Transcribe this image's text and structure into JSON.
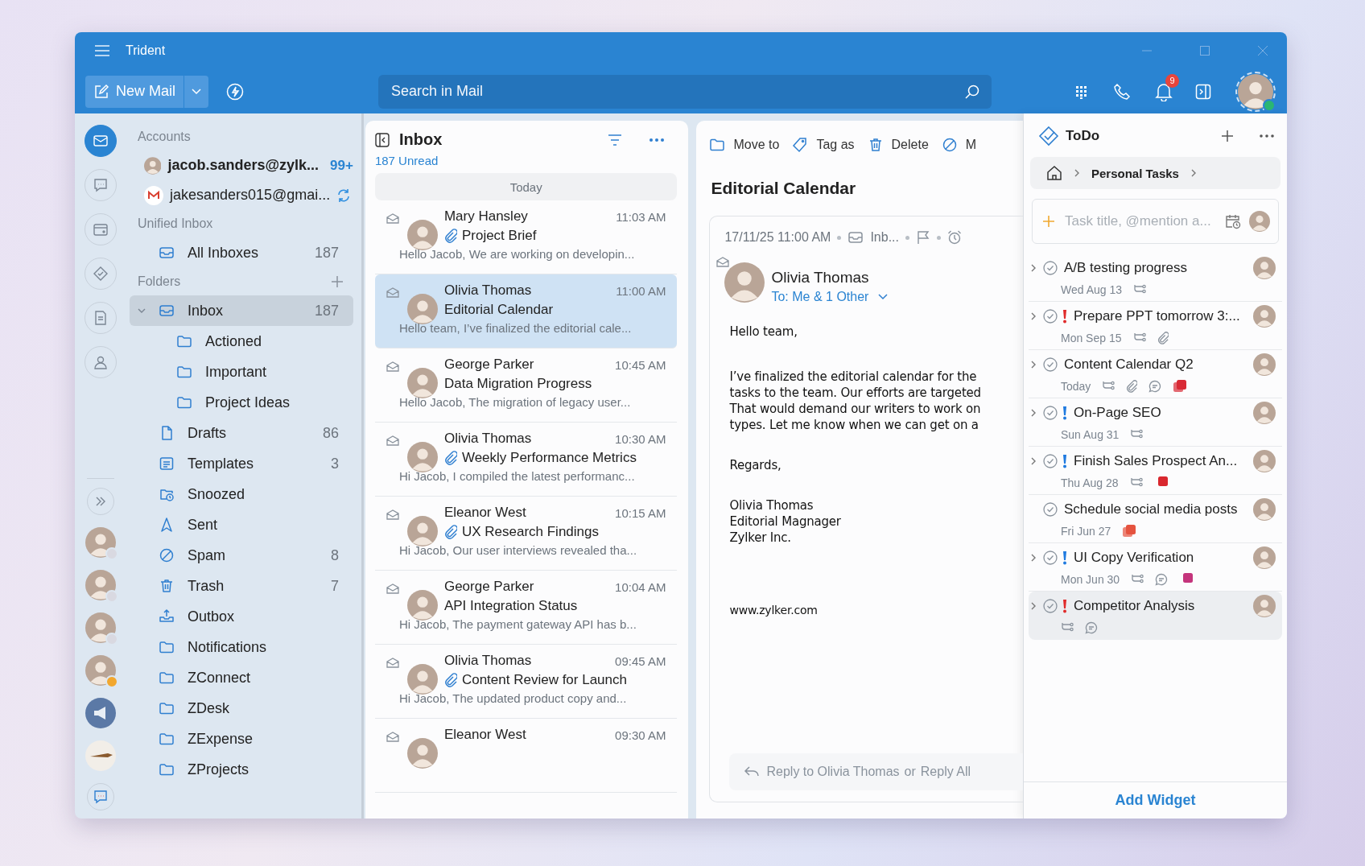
{
  "window": {
    "title": "Trident"
  },
  "toolbar": {
    "new_mail": "New Mail",
    "search_placeholder": "Search in Mail",
    "notification_count": "9"
  },
  "rail": {
    "apps": [
      {
        "kind": "mail",
        "selected": true
      },
      {
        "kind": "chat",
        "selected": false
      },
      {
        "kind": "drive",
        "selected": false
      },
      {
        "kind": "tasks",
        "selected": false
      },
      {
        "kind": "notes",
        "selected": false
      },
      {
        "kind": "contacts",
        "selected": false
      }
    ],
    "contacts": [
      {
        "kind": "person",
        "color": "#d9d9e1"
      },
      {
        "kind": "person",
        "color": "#d9d9e1"
      },
      {
        "kind": "person",
        "color": "#d9d9e1"
      },
      {
        "kind": "person",
        "color": "#f2a72e"
      },
      {
        "kind": "channel"
      },
      {
        "kind": "bot"
      }
    ]
  },
  "accounts": {
    "label": "Accounts",
    "items": [
      {
        "kind": "zoho",
        "email": "jacob.sanders@zylk...",
        "count": "99+",
        "syncing": false
      },
      {
        "kind": "gmail",
        "email": "jakesanders015@gmai...",
        "syncing": true
      }
    ]
  },
  "unified": {
    "label": "Unified Inbox",
    "items": [
      {
        "kind": "inbox",
        "label": "All Inboxes",
        "count": "187",
        "selected": false
      }
    ]
  },
  "folders": {
    "label": "Folders",
    "items": [
      {
        "kind": "inbox",
        "label": "Inbox",
        "count": "187",
        "selected": true,
        "expanded": true,
        "children": [
          {
            "kind": "folder",
            "label": "Actioned",
            "selected": false
          },
          {
            "kind": "folder",
            "label": "Important",
            "selected": false
          },
          {
            "kind": "folder",
            "label": "Project Ideas",
            "selected": false
          }
        ]
      },
      {
        "kind": "draft",
        "label": "Drafts",
        "count": "86",
        "selected": false
      },
      {
        "kind": "template",
        "label": "Templates",
        "count": "3",
        "selected": false
      },
      {
        "kind": "snooze",
        "label": "Snoozed",
        "selected": false
      },
      {
        "kind": "sent",
        "label": "Sent",
        "selected": false
      },
      {
        "kind": "spam",
        "label": "Spam",
        "count": "8",
        "selected": false
      },
      {
        "kind": "trash",
        "label": "Trash",
        "count": "7",
        "selected": false
      },
      {
        "kind": "outbox",
        "label": "Outbox",
        "selected": false
      },
      {
        "kind": "folder",
        "label": "Notifications",
        "selected": false
      },
      {
        "kind": "folder",
        "label": "ZConnect",
        "selected": false
      },
      {
        "kind": "folder",
        "label": "ZDesk",
        "selected": false
      },
      {
        "kind": "folder",
        "label": "ZExpense",
        "selected": false
      },
      {
        "kind": "folder",
        "label": "ZProjects",
        "selected": false
      }
    ]
  },
  "mail_list": {
    "title": "Inbox",
    "unread": "187 Unread",
    "group": "Today",
    "messages": [
      {
        "sender": "Mary Hansley",
        "time": "11:03 AM",
        "subject": "Project Brief",
        "attachment": true,
        "preview": "Hello Jacob, We are working on developin...",
        "selected": false
      },
      {
        "sender": "Olivia Thomas",
        "time": "11:00 AM",
        "subject": "Editorial Calendar",
        "attachment": false,
        "preview": "Hello team, I’ve finalized the editorial cale...",
        "selected": true
      },
      {
        "sender": "George Parker",
        "time": "10:45 AM",
        "subject": "Data Migration Progress",
        "attachment": false,
        "preview": "Hello Jacob, The migration of legacy user...",
        "selected": false
      },
      {
        "sender": "Olivia Thomas",
        "time": "10:30 AM",
        "subject": "Weekly Performance Metrics",
        "attachment": true,
        "preview": "Hi Jacob, I compiled the latest performanc...",
        "selected": false
      },
      {
        "sender": "Eleanor West",
        "time": "10:15 AM",
        "subject": "UX Research Findings",
        "attachment": true,
        "preview": "Hi Jacob, Our user interviews revealed tha...",
        "selected": false
      },
      {
        "sender": "George Parker",
        "time": "10:04 AM",
        "subject": "API Integration Status",
        "attachment": false,
        "preview": "Hi Jacob, The payment gateway API has b...",
        "selected": false
      },
      {
        "sender": "Olivia Thomas",
        "time": "09:45 AM",
        "subject": "Content Review for Launch",
        "attachment": true,
        "preview": "Hi Jacob, The updated product copy and...",
        "selected": false
      },
      {
        "sender": "Eleanor West",
        "time": "09:30 AM",
        "selected": false
      }
    ]
  },
  "reading": {
    "actions": [
      {
        "kind": "move",
        "label": "Move to"
      },
      {
        "kind": "tag",
        "label": "Tag as"
      },
      {
        "kind": "delete",
        "label": "Delete"
      },
      {
        "kind": "spam",
        "label": "M"
      }
    ],
    "subject": "Editorial Calendar",
    "date": "17/11/25 11:00 AM",
    "folder": "Inb...",
    "sender": "Olivia Thomas",
    "recipients": "To: Me & 1 Other",
    "body": [
      [
        "Hello team,"
      ],
      [
        "I’ve finalized the editorial calendar for the",
        "tasks to the team. Our efforts are targeted",
        "That would demand our writers to work on",
        "types. Let me know when we can get on a"
      ],
      [
        "Regards,"
      ],
      [
        "Olivia Thomas",
        "Editorial Magnager",
        "Zylker Inc."
      ]
    ],
    "website": "www.zylker.com",
    "reply": {
      "reply": "Reply to Olivia Thomas",
      "or": "or",
      "reply_all": "Reply All"
    }
  },
  "todo": {
    "title": "ToDo",
    "breadcrumb": "Personal Tasks",
    "placeholder": "Task title, @mention a...",
    "tasks": [
      {
        "title": "A/B testing progress",
        "date": "Wed Aug 13",
        "expandable": true,
        "icons": [
          {
            "kind": "subtasks"
          }
        ],
        "selected": false
      },
      {
        "title": "Prepare PPT tomorrow 3:...",
        "date": "Mon Sep 15",
        "priority": {
          "color": "#e02b2b"
        },
        "expandable": true,
        "icons": [
          {
            "kind": "subtasks"
          },
          {
            "kind": "attachment"
          }
        ],
        "selected": false
      },
      {
        "title": "Content Calendar Q2",
        "date": "Today",
        "expandable": true,
        "icons": [
          {
            "kind": "subtasks"
          },
          {
            "kind": "attachment"
          },
          {
            "kind": "comment"
          }
        ],
        "tag": {
          "color": "#d92a35",
          "stacked": true
        },
        "selected": false
      },
      {
        "title": "On-Page SEO",
        "date": "Sun Aug 31",
        "priority": {
          "color": "#1f7ae0"
        },
        "expandable": true,
        "icons": [
          {
            "kind": "subtasks"
          }
        ],
        "selected": false
      },
      {
        "title": "Finish Sales Prospect An...",
        "date": "Thu Aug 28",
        "priority": {
          "color": "#1f7ae0"
        },
        "expandable": true,
        "icons": [
          {
            "kind": "subtasks"
          }
        ],
        "tag": {
          "color": "#d9272e",
          "stacked": false
        },
        "selected": false
      },
      {
        "title": "Schedule social media posts",
        "date": "Fri Jun 27",
        "expandable": false,
        "tag": {
          "color": "#e5533f",
          "stacked": true
        },
        "selected": false
      },
      {
        "title": "UI Copy Verification",
        "date": "Mon Jun 30",
        "priority": {
          "color": "#1f7ae0"
        },
        "expandable": true,
        "icons": [
          {
            "kind": "subtasks"
          },
          {
            "kind": "comment"
          }
        ],
        "tag": {
          "color": "#c4347c",
          "stacked": false
        },
        "selected": false
      },
      {
        "title": "Competitor Analysis",
        "priority": {
          "color": "#e02b2b"
        },
        "expandable": true,
        "icons": [
          {
            "kind": "subtasks"
          },
          {
            "kind": "comment"
          }
        ],
        "selected": true
      }
    ],
    "footer": "Add Widget"
  }
}
